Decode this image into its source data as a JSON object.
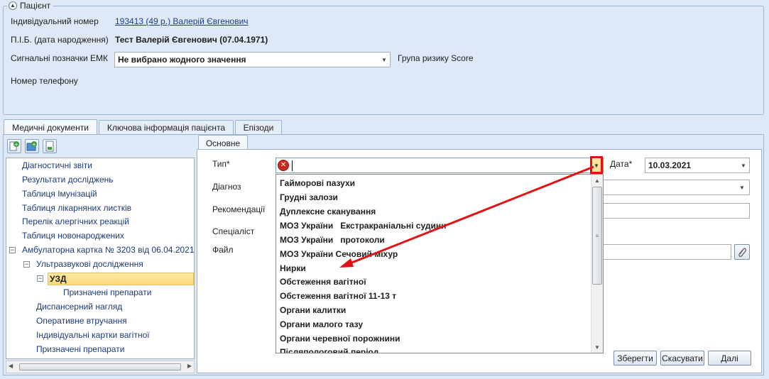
{
  "patient": {
    "legend": "Пацієнт",
    "id_label": "Індивідуальний номер",
    "id_value": "193413 (49 р.) Валерій Євгенович",
    "name_label": "П.І.Б. (дата народження)",
    "name_value": "Тест Валерій Євгенович (07.04.1971)",
    "signals_label": "Сигнальні позначки ЕМК",
    "signals_value": "Не вибрано жодного значення",
    "score_label": "Група ризику Score",
    "phone_label": "Номер телефону"
  },
  "tabs": [
    {
      "label": "Медичні документи"
    },
    {
      "label": "Ключова інформація пацієнта"
    },
    {
      "label": "Епізоди"
    }
  ],
  "tree": {
    "items": [
      {
        "label": "Діагностичні звіти"
      },
      {
        "label": "Результати досліджень"
      },
      {
        "label": "Таблиця Імунізацій"
      },
      {
        "label": "Таблиця лікарняних листків"
      },
      {
        "label": "Перелік алергічних реакцій"
      },
      {
        "label": "Таблиця новонароджених"
      },
      {
        "label": "Амбулаторна картка № 3203 від 06.04.2021"
      },
      {
        "label": "Ультразвукові дослідження"
      },
      {
        "label": "УЗД"
      },
      {
        "label": "Призначені препарати"
      },
      {
        "label": "Диспансерний нагляд"
      },
      {
        "label": "Оперативне втручання"
      },
      {
        "label": "Індивідуальні картки вагітної"
      },
      {
        "label": "Призначені препарати"
      }
    ]
  },
  "form": {
    "tab": "Основне",
    "type_label": "Тип*",
    "diagnosis_label": "Діагноз",
    "recommendations_label": "Рекомендації",
    "specialist_label": "Спеціаліст",
    "file_label": "Файл",
    "date_label": "Дата*",
    "date_value": "10.03.2021"
  },
  "dropdown": {
    "options": [
      "Гайморові пазухи",
      "Грудні залози",
      "Дуплексне сканування",
      "МОЗ України   Екстракраніальні судини",
      "МОЗ України   протоколи",
      "МОЗ України Сечовий міхур",
      "Нирки",
      "Обстеження вагітної",
      "Обстеження вагітної 11-13 т",
      "Органи калитки",
      "Органи малого тазу",
      "Органи черевної порожнини",
      "Післяпологовий період"
    ]
  },
  "buttons": {
    "save": "Зберегти",
    "cancel": "Скасувати",
    "next": "Далі"
  },
  "colors": {
    "annotation_red": "#e01212",
    "selection_yellow": "#f9d77c"
  }
}
